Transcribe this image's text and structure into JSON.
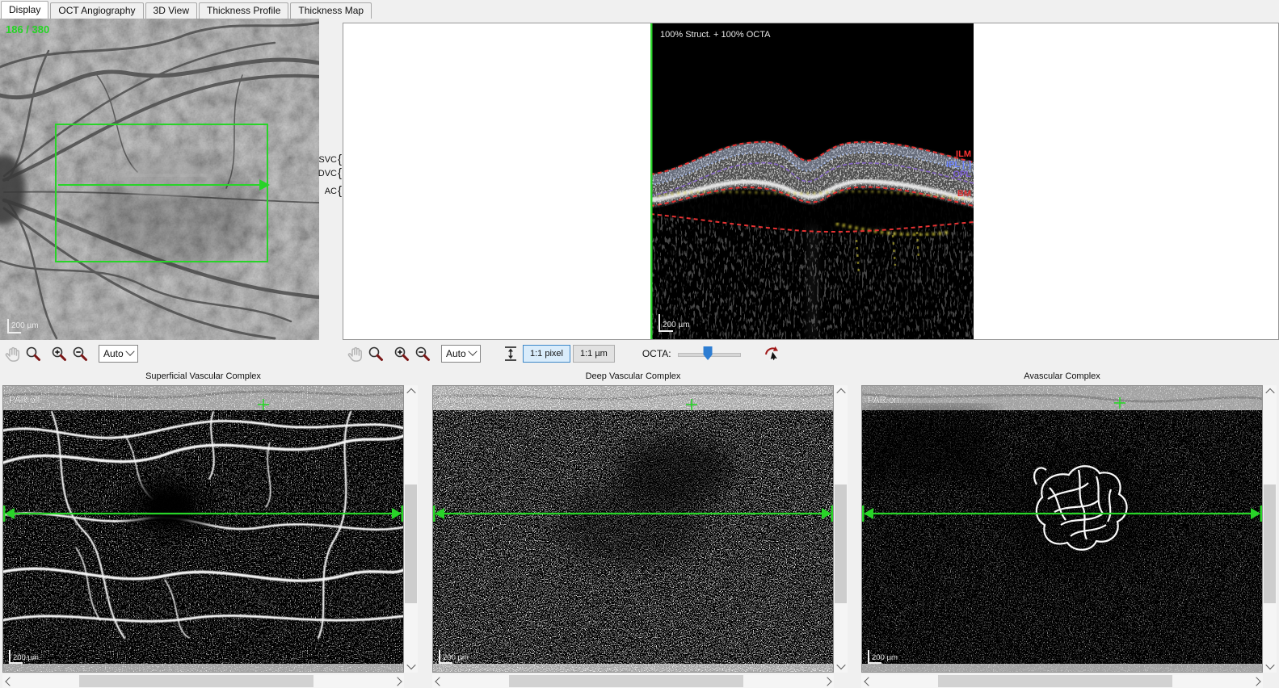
{
  "window": {
    "tabs": [
      {
        "label": "Display",
        "active": true
      },
      {
        "label": "OCT Angiography",
        "active": false
      },
      {
        "label": "3D View",
        "active": false
      },
      {
        "label": "Thickness Profile",
        "active": false
      },
      {
        "label": "Thickness Map",
        "active": false
      }
    ]
  },
  "fundus": {
    "frame_counter": "186 / 380",
    "scale_label": "200 µm"
  },
  "bscan": {
    "overlay_label": "100% Struct. + 100% OCTA",
    "scale_label": "200 µm",
    "brace": "{",
    "slab_labels": [
      {
        "label": "SVC"
      },
      {
        "label": "DVC"
      },
      {
        "label": "AC"
      }
    ],
    "boundary_labels": [
      {
        "label": "ILM",
        "color": "#ff3333"
      },
      {
        "label": "IPL [-]",
        "color": "#6f86ff"
      },
      {
        "label": "OPL",
        "color": "#7d5fd8"
      },
      {
        "label": "BM",
        "color": "#e03030"
      }
    ]
  },
  "fundus_toolbar": {
    "zoom_select": "Auto"
  },
  "bscan_toolbar": {
    "zoom_select": "Auto",
    "one_to_one_pixel": "1:1 pixel",
    "one_to_one_micron": "1:1 µm",
    "octa_label": "OCTA:",
    "octa_blend_percent": 48
  },
  "toolbar_icons": [
    "hand",
    "magnifier",
    "zoom-in",
    "zoom-out",
    "fit-height",
    "pointer-rotate"
  ],
  "angio_panels": [
    {
      "title": "Superficial Vascular Complex",
      "par_label": "PAR off",
      "scale_label": "200 µm"
    },
    {
      "title": "Deep Vascular Complex",
      "par_label": "PAR on",
      "scale_label": "200 µm"
    },
    {
      "title": "Avascular Complex",
      "par_label": "PAR on",
      "scale_label": "200 µm"
    }
  ],
  "colors": {
    "overlay_green": "#28d428",
    "selected_button_bg": "#d9ecfb",
    "selected_button_border": "#3c87c8",
    "slider_thumb": "#2d7dd2",
    "ilm_red": "#e63232",
    "ipl_blue": "#a8bcec",
    "opl_purple": "#8666c8"
  }
}
